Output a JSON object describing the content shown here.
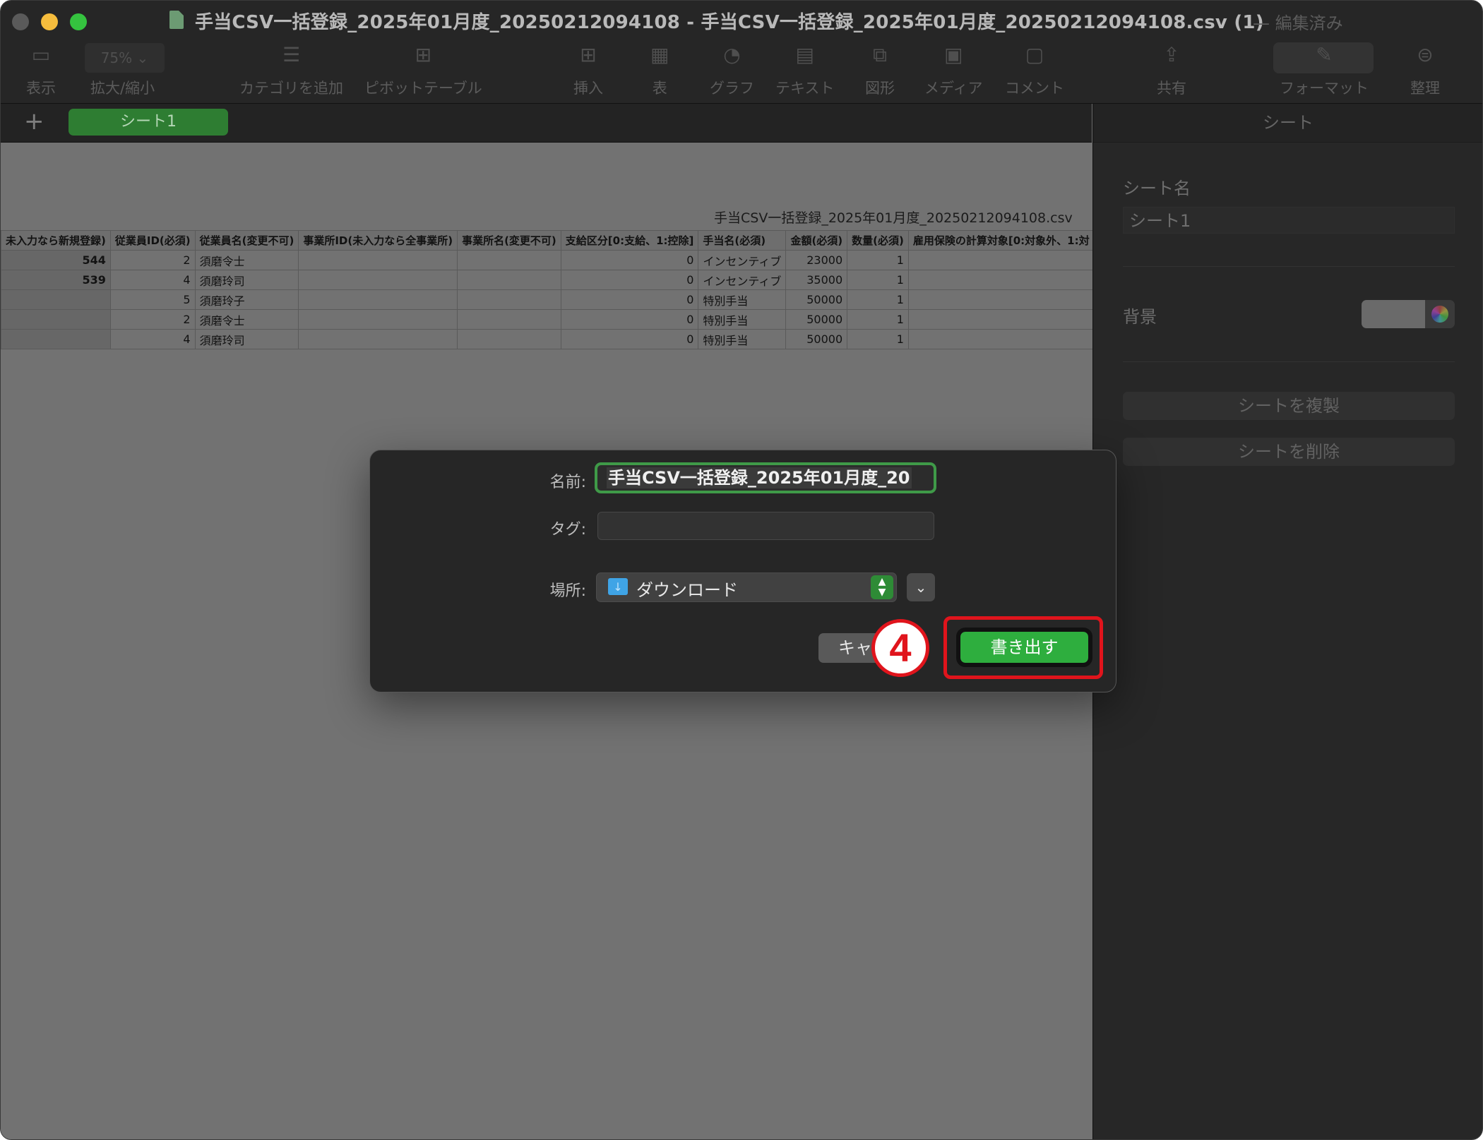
{
  "window": {
    "title": "手当CSV一括登録_2025年01月度_20250212094108 - 手当CSV一括登録_2025年01月度_20250212094108.csv (1)",
    "status": "— 編集済み"
  },
  "toolbar": {
    "zoom_value": "75%",
    "items": [
      {
        "label": "表示",
        "icon": "sidebar-icon"
      },
      {
        "label": "拡大/縮小",
        "icon": "zoom-icon"
      },
      {
        "label": "カテゴリを追加",
        "icon": "list-icon"
      },
      {
        "label": "ピボットテーブル",
        "icon": "pivot-table-icon"
      },
      {
        "label": "挿入",
        "icon": "insert-icon"
      },
      {
        "label": "表",
        "icon": "table-icon"
      },
      {
        "label": "グラフ",
        "icon": "chart-icon"
      },
      {
        "label": "テキスト",
        "icon": "text-box-icon"
      },
      {
        "label": "図形",
        "icon": "shape-icon"
      },
      {
        "label": "メディア",
        "icon": "media-icon"
      },
      {
        "label": "コメント",
        "icon": "comment-icon"
      },
      {
        "label": "共有",
        "icon": "share-icon"
      },
      {
        "label": "フォーマット",
        "icon": "format-brush-icon"
      },
      {
        "label": "整理",
        "icon": "organize-icon"
      }
    ]
  },
  "sheets": {
    "add_icon": "plus-icon",
    "active_tab": "シート1"
  },
  "table": {
    "title": "手当CSV一括登録_2025年01月度_20250212094108.csv",
    "columns": [
      "未入力なら新規登録)",
      "従業員ID(必須)",
      "従業員名(変更不可)",
      "事業所ID(未入力なら全事業所)",
      "事業所名(変更不可)",
      "支給区分[0:支給、1:控除]",
      "手当名(必須)",
      "金額(必須)",
      "数量(必須)",
      "雇用保険の計算対象[0:対象外、1:対"
    ],
    "rows": [
      [
        "544",
        "2",
        "須磨令士",
        "",
        "",
        "0",
        "インセンティブ",
        "23000",
        "1",
        ""
      ],
      [
        "539",
        "4",
        "須磨玲司",
        "",
        "",
        "0",
        "インセンティブ",
        "35000",
        "1",
        ""
      ],
      [
        "",
        "5",
        "須磨玲子",
        "",
        "",
        "0",
        "特別手当",
        "50000",
        "1",
        ""
      ],
      [
        "",
        "2",
        "須磨令士",
        "",
        "",
        "0",
        "特別手当",
        "50000",
        "1",
        ""
      ],
      [
        "",
        "4",
        "須磨玲司",
        "",
        "",
        "0",
        "特別手当",
        "50000",
        "1",
        ""
      ]
    ]
  },
  "inspector": {
    "header": "シート",
    "name_label": "シート名",
    "name_value": "シート1",
    "background_label": "背景",
    "duplicate_button": "シートを複製",
    "delete_button": "シートを削除"
  },
  "dialog": {
    "name_label": "名前:",
    "name_value": "手当CSV一括登録_2025年01月度_20",
    "tag_label": "タグ:",
    "tag_value": "",
    "location_label": "場所:",
    "location_value": "ダウンロード",
    "location_icon": "downloads-folder-icon",
    "cancel_label": "キャ",
    "export_label": "書き出す",
    "step_number": "4"
  },
  "colors": {
    "accent_green": "#2eae3e",
    "annotation_red": "#e0141c"
  }
}
